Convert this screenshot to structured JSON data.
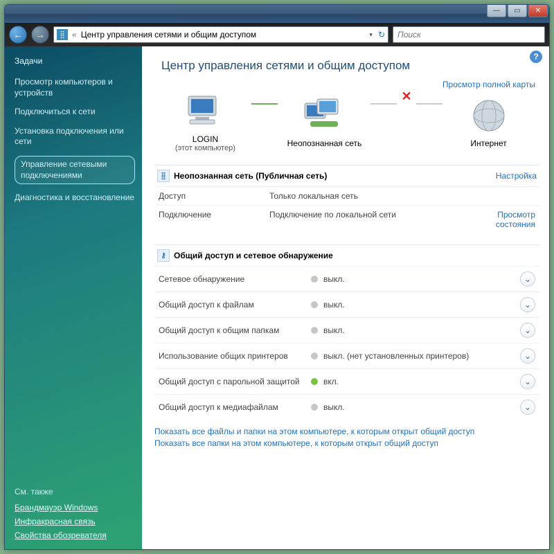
{
  "address": {
    "crumb_prefix": "«",
    "crumb": "Центр управления сетями и общим доступом"
  },
  "search": {
    "placeholder": "Поиск"
  },
  "sidebar": {
    "heading": "Задачи",
    "items": [
      "Просмотр компьютеров и устройств",
      "Подключиться к сети",
      "Установка подключения или сети",
      "Управление сетевыми подключениями",
      "Диагностика и восстановление"
    ],
    "see_also": "См. также",
    "footer": [
      "Брандмауэр Windows",
      "Инфракрасная связь",
      "Свойства обозревателя"
    ]
  },
  "content": {
    "title": "Центр управления сетями и общим доступом",
    "full_map": "Просмотр полной карты",
    "nodes": {
      "this_pc": {
        "label": "LOGIN",
        "sub": "(этот компьютер)"
      },
      "network": {
        "label": "Неопознанная сеть"
      },
      "internet": {
        "label": "Интернет"
      }
    },
    "net_section": {
      "title": "Неопознанная сеть (Публичная сеть)",
      "customize": "Настройка",
      "rows": [
        {
          "k": "Доступ",
          "v": "Только локальная сеть",
          "link": ""
        },
        {
          "k": "Подключение",
          "v": "Подключение по локальной сети",
          "link": "Просмотр состояния"
        }
      ]
    },
    "sharing": {
      "title": "Общий доступ и сетевое обнаружение",
      "rows": [
        {
          "k": "Сетевое обнаружение",
          "on": false,
          "v": "выкл."
        },
        {
          "k": "Общий доступ к файлам",
          "on": false,
          "v": "выкл."
        },
        {
          "k": "Общий доступ к общим папкам",
          "on": false,
          "v": "выкл."
        },
        {
          "k": "Использование общих принтеров",
          "on": false,
          "v": "выкл. (нет установленных принтеров)"
        },
        {
          "k": "Общий доступ с парольной защитой",
          "on": true,
          "v": "вкл."
        },
        {
          "k": "Общий доступ к медиафайлам",
          "on": false,
          "v": "выкл."
        }
      ]
    },
    "footer_links": [
      "Показать все файлы и папки на этом компьютере, к которым открыт общий доступ",
      "Показать все папки на этом компьютере, к которым открыт общий доступ"
    ]
  }
}
